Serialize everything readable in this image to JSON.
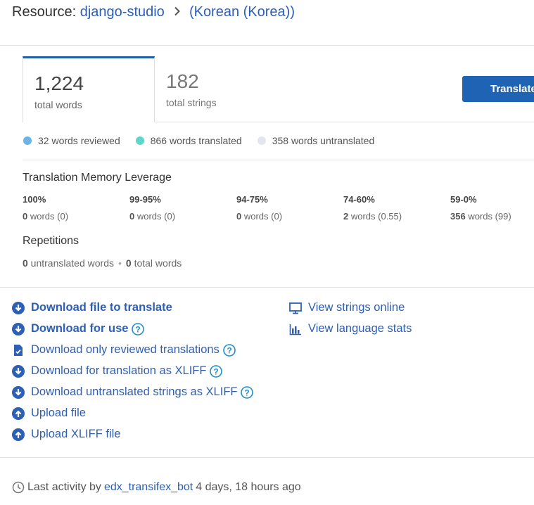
{
  "header": {
    "prefix": "Resource:",
    "resource_link": "django-studio",
    "language_link": "(Korean (Korea))"
  },
  "tabs": [
    {
      "number": "1,224",
      "label": "total words"
    },
    {
      "number": "182",
      "label": "total strings"
    }
  ],
  "translate_button": "Translate",
  "legend": [
    {
      "label": "32 words reviewed",
      "color": "#6cb4e4"
    },
    {
      "label": "866 words translated",
      "color": "#5ed6c8"
    },
    {
      "label": "358 words untranslated",
      "color": "#e4e6ee"
    }
  ],
  "tm_leverage": {
    "title": "Translation Memory Leverage",
    "columns": [
      {
        "pct": "100%",
        "count": "0",
        "rest": " words (0)"
      },
      {
        "pct": "99-95%",
        "count": "0",
        "rest": " words (0)"
      },
      {
        "pct": "94-75%",
        "count": "0",
        "rest": " words (0)"
      },
      {
        "pct": "74-60%",
        "count": "2",
        "rest": " words (0.55)"
      },
      {
        "pct": "59-0%",
        "count": "356",
        "rest": " words (99)"
      }
    ]
  },
  "repetitions": {
    "title": "Repetitions",
    "untranslated_count": "0",
    "untranslated_label": " untranslated words",
    "total_count": "0",
    "total_label": " total words"
  },
  "actions_left": [
    {
      "label": "Download file to translate",
      "icon": "download-circle-icon",
      "bold": true,
      "help": false
    },
    {
      "label": "Download for use",
      "icon": "download-circle-icon",
      "bold": true,
      "help": true
    },
    {
      "label": "Download only reviewed translations",
      "icon": "file-check-icon",
      "bold": false,
      "help": true
    },
    {
      "label": "Download for translation as XLIFF",
      "icon": "download-circle-icon",
      "bold": false,
      "help": true
    },
    {
      "label": "Download untranslated strings as XLIFF",
      "icon": "download-circle-icon",
      "bold": false,
      "help": true
    },
    {
      "label": "Upload file",
      "icon": "upload-circle-icon",
      "bold": false,
      "help": false
    },
    {
      "label": "Upload XLIFF file",
      "icon": "upload-circle-icon",
      "bold": false,
      "help": false
    }
  ],
  "actions_right": [
    {
      "label": "View strings online",
      "icon": "monitor-icon"
    },
    {
      "label": "View language stats",
      "icon": "bar-chart-icon"
    }
  ],
  "footer": {
    "prefix": "Last activity by",
    "user": "edx_transifex_bot",
    "time": "4 days, 18 hours ago"
  }
}
